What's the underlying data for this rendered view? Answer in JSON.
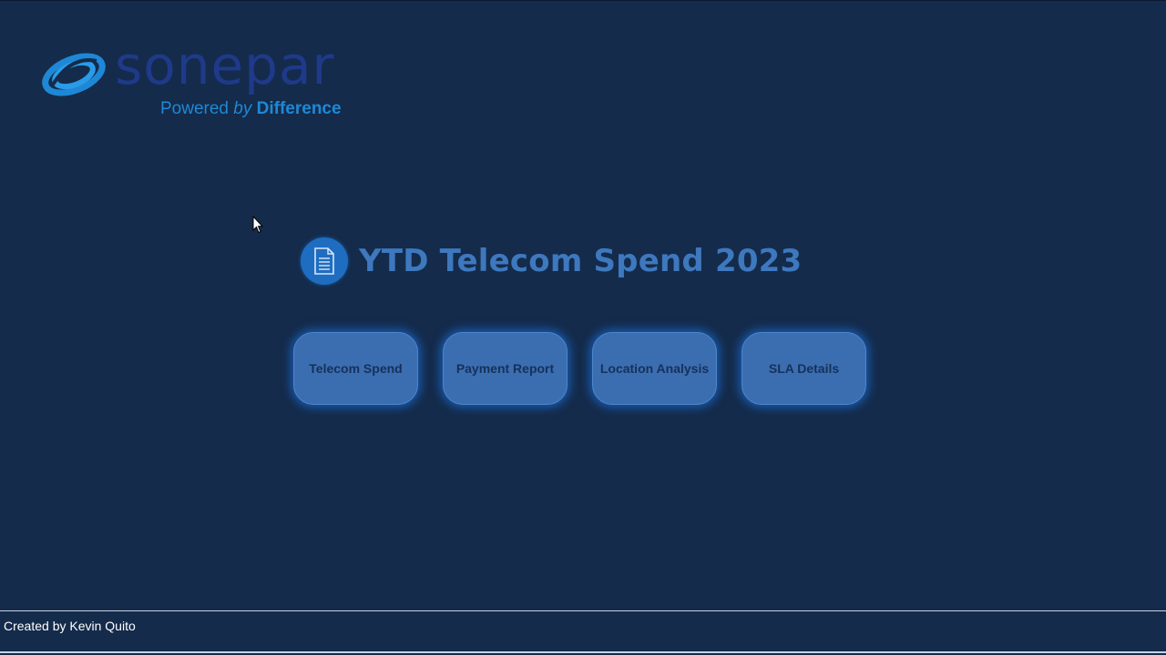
{
  "brand": {
    "name": "sonepar",
    "tagline_prefix": "Powered",
    "tagline_by": "by",
    "tagline_emphasis": "Difference"
  },
  "header": {
    "title": "YTD Telecom Spend 2023",
    "title_icon": "document-icon"
  },
  "nav": {
    "buttons": [
      {
        "label": "Telecom Spend"
      },
      {
        "label": "Payment Report"
      },
      {
        "label": "Location Analysis"
      },
      {
        "label": "SLA Details"
      }
    ]
  },
  "footer": {
    "credit": "Created by Kevin Quito"
  },
  "colors": {
    "background": "#142b4b",
    "title": "#3e78be",
    "button_fill": "#3b6eb0",
    "button_glow": "#1e82ff",
    "brand_wordmark": "#1f3a8a",
    "brand_tagline": "#1e88d6"
  }
}
